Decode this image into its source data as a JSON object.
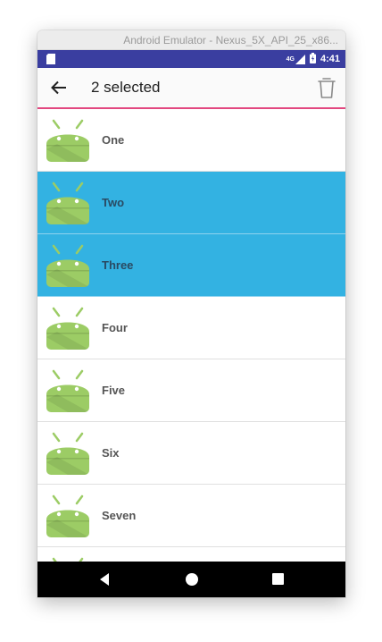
{
  "window": {
    "title": "Android Emulator - Nexus_5X_API_25_x86..."
  },
  "status_bar": {
    "network": "4G",
    "time": "4:41"
  },
  "toolbar": {
    "title": "2 selected"
  },
  "items": [
    {
      "label": "One",
      "selected": false
    },
    {
      "label": "Two",
      "selected": true
    },
    {
      "label": "Three",
      "selected": true
    },
    {
      "label": "Four",
      "selected": false
    },
    {
      "label": "Five",
      "selected": false
    },
    {
      "label": "Six",
      "selected": false
    },
    {
      "label": "Seven",
      "selected": false
    }
  ],
  "colors": {
    "status_bar": "#3a3ea0",
    "selection": "#33b2e2",
    "accent_line": "#e2477f",
    "android_green": "#9ccc65"
  }
}
